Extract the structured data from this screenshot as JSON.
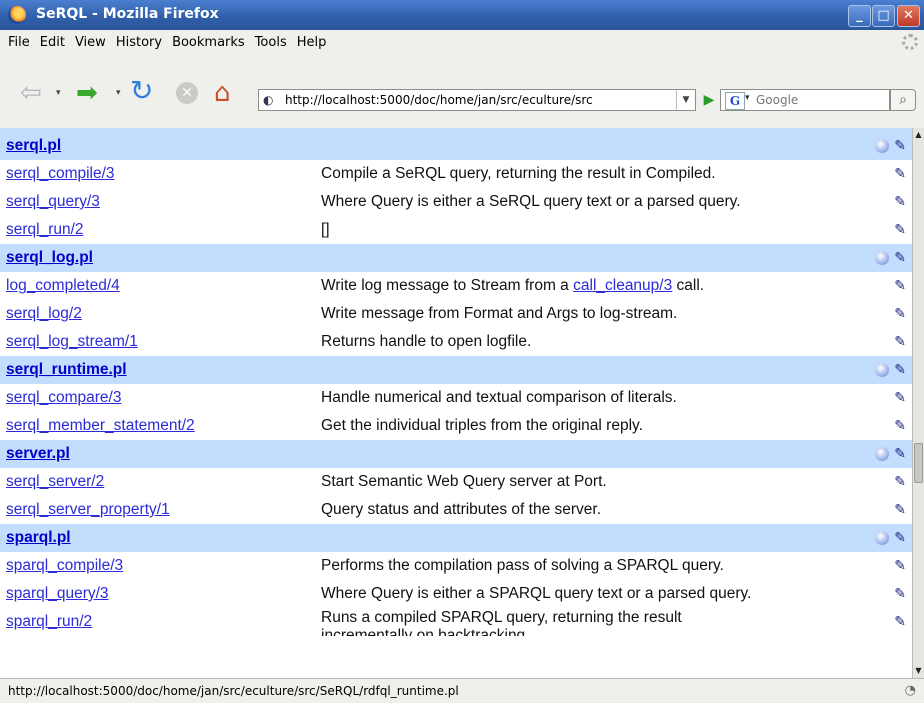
{
  "window": {
    "title": "SeRQL - Mozilla Firefox"
  },
  "menu": [
    "File",
    "Edit",
    "View",
    "History",
    "Bookmarks",
    "Tools",
    "Help"
  ],
  "address": {
    "url": "http://localhost:5000/doc/home/jan/src/eculture/src"
  },
  "search": {
    "placeholder": "Google"
  },
  "files": [
    {
      "name": "serql.pl",
      "preds": [
        {
          "name": "serql_compile/3",
          "desc": "Compile a SeRQL query, returning the result in Compiled."
        },
        {
          "name": "serql_query/3",
          "desc": "Where Query is either a SeRQL query text or a parsed query."
        },
        {
          "name": "serql_run/2",
          "desc": "[]"
        }
      ]
    },
    {
      "name": "serql_log.pl",
      "preds": [
        {
          "name": "log_completed/4",
          "desc_pre": "Write log message to Stream from a ",
          "desc_link": "call_cleanup/3",
          "desc_post": " call."
        },
        {
          "name": "serql_log/2",
          "desc": "Write message from Format and Args to log-stream."
        },
        {
          "name": "serql_log_stream/1",
          "desc": "Returns handle to open logfile."
        }
      ]
    },
    {
      "name": "serql_runtime.pl",
      "preds": [
        {
          "name": "serql_compare/3",
          "desc": "Handle numerical and textual comparison of literals."
        },
        {
          "name": "serql_member_statement/2",
          "desc": "Get the individual triples from the original reply."
        }
      ]
    },
    {
      "name": "server.pl",
      "preds": [
        {
          "name": "serql_server/2",
          "desc": "Start Semantic Web Query server at Port."
        },
        {
          "name": "serql_server_property/1",
          "desc": "Query status and attributes of the server."
        }
      ]
    },
    {
      "name": "sparql.pl",
      "preds": [
        {
          "name": "sparql_compile/3",
          "desc": "Performs the compilation pass of solving a SPARQL query."
        },
        {
          "name": "sparql_query/3",
          "desc": "Where Query is either a SPARQL query text or a parsed query."
        },
        {
          "name": "sparql_run/2",
          "desc": "Runs a compiled SPARQL query, returning the result",
          "desc2": "incrementally on backtracking"
        }
      ]
    }
  ],
  "statusbar": {
    "text": "http://localhost:5000/doc/home/jan/src/eculture/src/SeRQL/rdfql_runtime.pl"
  }
}
